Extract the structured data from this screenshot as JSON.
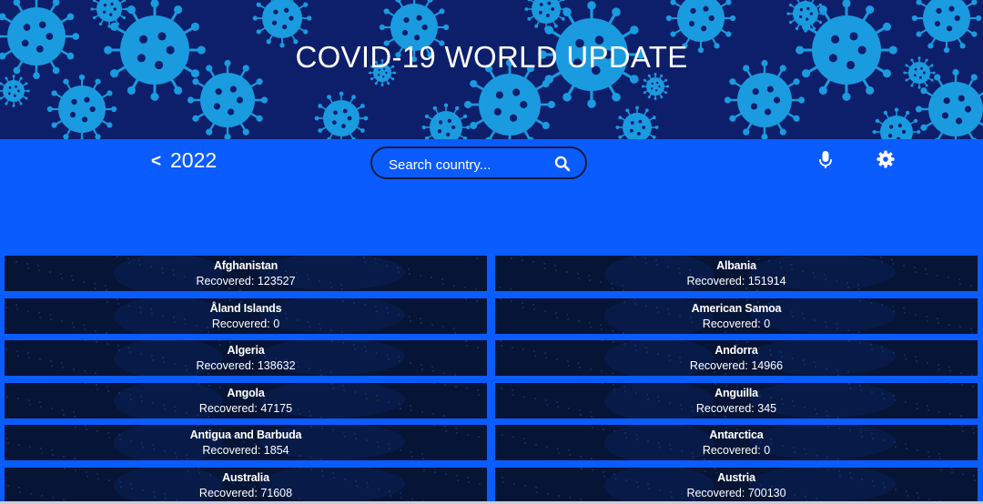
{
  "header": {
    "title": "COVID-19 WORLD UPDATE"
  },
  "toolbar": {
    "back_label": "<",
    "year": "2022",
    "search_placeholder": "Search country...",
    "search_icon": "search-icon",
    "mic_icon": "microphone-icon",
    "settings_icon": "gear-icon"
  },
  "recovered_label": "Recovered: ",
  "countries": [
    {
      "name": "Afghanistan",
      "recovered": "Recovered: 123527"
    },
    {
      "name": "Albania",
      "recovered": "Recovered: 151914"
    },
    {
      "name": "Åland Islands",
      "recovered": "Recovered: 0"
    },
    {
      "name": "American Samoa",
      "recovered": "Recovered: 0"
    },
    {
      "name": "Algeria",
      "recovered": "Recovered: 138632"
    },
    {
      "name": "Andorra",
      "recovered": "Recovered: 14966"
    },
    {
      "name": "Angola",
      "recovered": "Recovered: 47175"
    },
    {
      "name": "Anguilla",
      "recovered": "Recovered: 345"
    },
    {
      "name": "Antigua and Barbuda",
      "recovered": "Recovered: 1854"
    },
    {
      "name": "Antarctica",
      "recovered": "Recovered: 0"
    },
    {
      "name": "Australia",
      "recovered": "Recovered: 71608"
    },
    {
      "name": "Austria",
      "recovered": "Recovered: 700130"
    }
  ],
  "colors": {
    "page_bg": "#0a5cff",
    "hero_bg": "#0d1f6b",
    "virus": "#1a9be0",
    "card_bg": "#061436"
  }
}
